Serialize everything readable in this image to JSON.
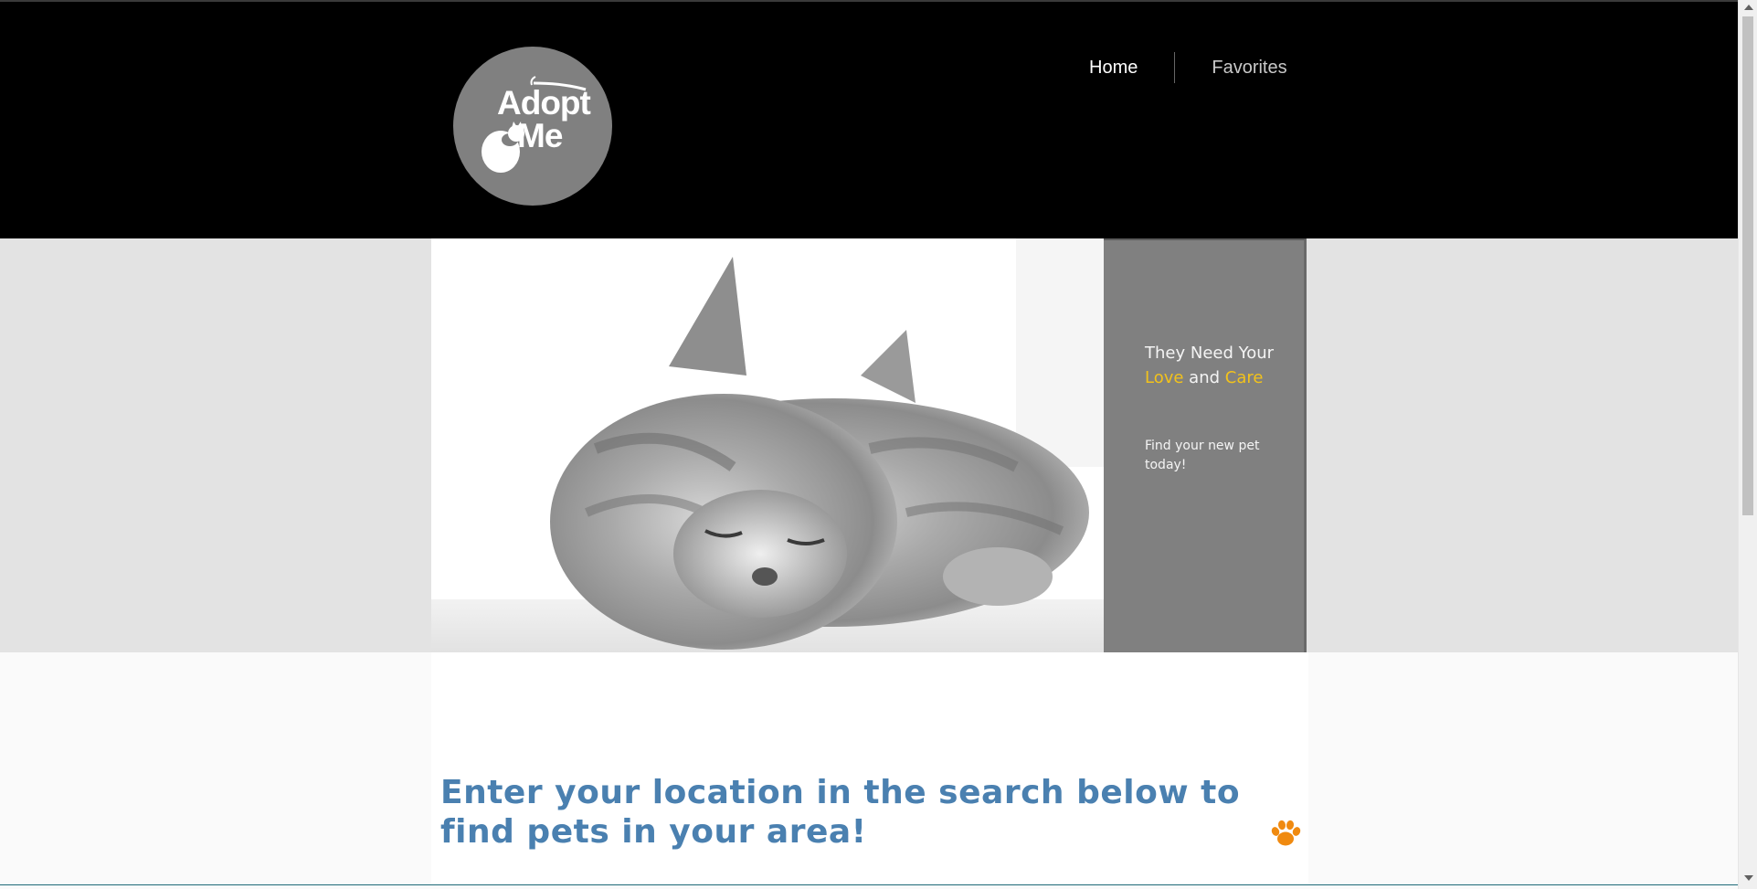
{
  "logo": {
    "line1": "Adopt",
    "line2": "Me",
    "icon": "cat-silhouette-icon"
  },
  "nav": {
    "home_label": "Home",
    "favorites_label": "Favorites"
  },
  "hero": {
    "image_subject": "sleeping-gray-kitten",
    "heading_part1": "They Need Your ",
    "heading_love": "Love",
    "heading_part2": " and ",
    "heading_care": "Care",
    "subtext": "Find your new pet today!"
  },
  "main": {
    "search_prompt": "Enter your location in the search below to find pets in your area!",
    "paw_icon": "paw-icon"
  },
  "colors": {
    "header_bg": "#000000",
    "logo_bg": "#808080",
    "accent_yellow": "#f2c21b",
    "heading_blue": "#4a80b0",
    "paw_orange": "#f08a10",
    "hero_panel_bg": "#808080",
    "hero_band_bg": "#e3e3e3"
  }
}
